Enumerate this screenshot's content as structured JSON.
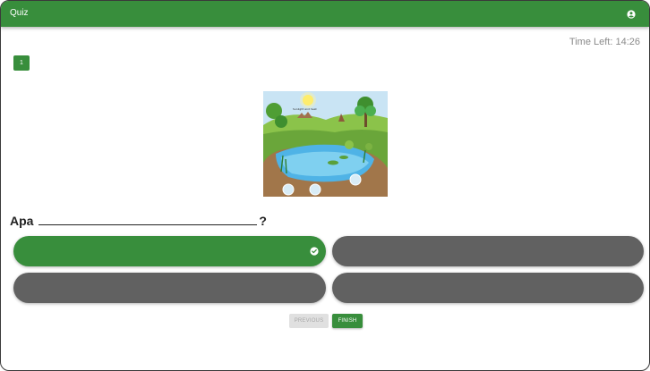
{
  "app": {
    "title": "Quiz",
    "account_icon": "account-circle-icon"
  },
  "timer": {
    "text": "Time Left: 14:26"
  },
  "question_nav": {
    "current": "1"
  },
  "question": {
    "prefix": "Apa",
    "suffix": "?"
  },
  "options": [
    {
      "label": "",
      "selected": true
    },
    {
      "label": "",
      "selected": false
    },
    {
      "label": "",
      "selected": false
    },
    {
      "label": "",
      "selected": false
    }
  ],
  "scene": {
    "sun_label": "Sunlight and heat"
  },
  "buttons": {
    "previous": "PREVIOUS",
    "finish": "FINISH"
  },
  "colors": {
    "primary": "#388e3c",
    "option_unselected": "#616161",
    "disabled": "#e0e0e0"
  }
}
